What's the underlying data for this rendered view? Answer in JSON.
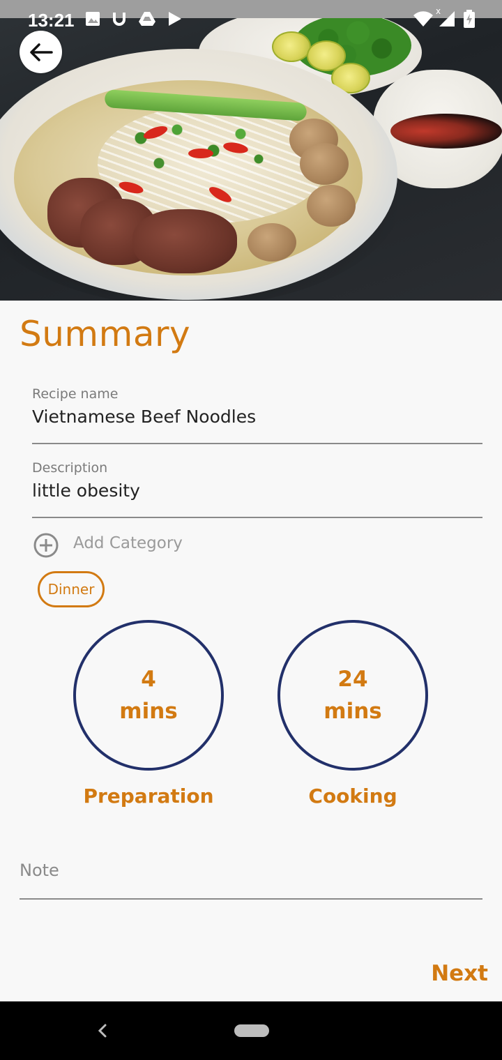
{
  "status_bar": {
    "time": "13:21",
    "icons": [
      "image-icon",
      "u-icon",
      "drive-icon",
      "play-icon",
      "wifi-icon",
      "signal-icon",
      "battery-charging-icon"
    ]
  },
  "hero": {
    "image_description_icon": "food-photo"
  },
  "header": {
    "back_icon": "arrow-left-icon"
  },
  "summary": {
    "title": "Summary",
    "recipe_name": {
      "label": "Recipe name",
      "value": "Vietnamese Beef Noodles"
    },
    "description": {
      "label": "Description",
      "value": "little obesity"
    },
    "add_category": {
      "icon": "plus-circle-icon",
      "label": "Add Category"
    },
    "categories": [
      "Dinner"
    ],
    "times": [
      {
        "value": "4",
        "unit": "mins",
        "label": "Preparation"
      },
      {
        "value": "24",
        "unit": "mins",
        "label": "Cooking"
      }
    ],
    "note": {
      "placeholder": "Note"
    },
    "next_label": "Next"
  },
  "colors": {
    "accent": "#d27a12",
    "ring": "#22306a",
    "background": "#f8f8f8"
  }
}
